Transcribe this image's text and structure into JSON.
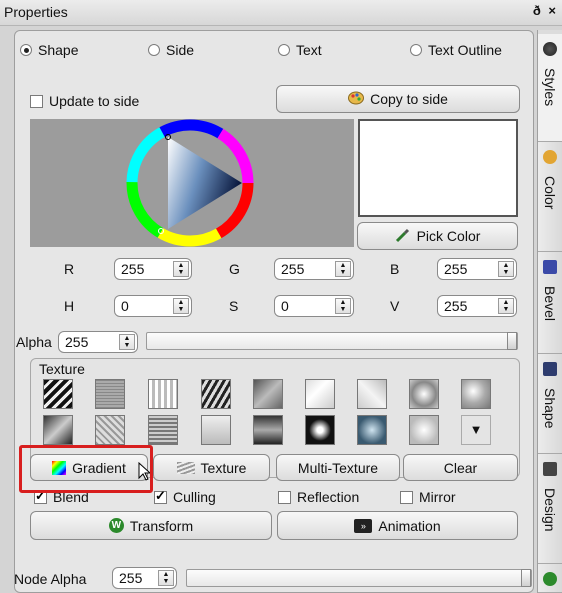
{
  "window": {
    "title": "Properties",
    "controls": "ð ×"
  },
  "mode_radios": [
    {
      "label": "Shape",
      "selected": true
    },
    {
      "label": "Side",
      "selected": false
    },
    {
      "label": "Text",
      "selected": false
    },
    {
      "label": "Text Outline",
      "selected": false
    }
  ],
  "update_to_side": {
    "label": "Update to side",
    "checked": false
  },
  "copy_to_side": {
    "label": "Copy to side",
    "icon": "palette-icon"
  },
  "color_picker": {
    "current_color": "#ffffff",
    "pick_color_label": "Pick Color",
    "pick_icon": "eyedropper-icon"
  },
  "rgb": {
    "r_label": "R",
    "r": "255",
    "g_label": "G",
    "g": "255",
    "b_label": "B",
    "b": "255"
  },
  "hsv": {
    "h_label": "H",
    "h": "0",
    "s_label": "S",
    "s": "0",
    "v_label": "V",
    "v": "255"
  },
  "alpha": {
    "label": "Alpha",
    "value": "255",
    "level": 1.0
  },
  "texture": {
    "title": "Texture"
  },
  "texture_buttons": [
    {
      "label": "Gradient",
      "icon": "gradient-icon"
    },
    {
      "label": "Texture",
      "icon": "texture-icon"
    },
    {
      "label": "Multi-Texture"
    },
    {
      "label": "Clear"
    }
  ],
  "options": [
    {
      "label": "Blend",
      "checked": true
    },
    {
      "label": "Culling",
      "checked": true
    },
    {
      "label": "Reflection",
      "checked": false
    },
    {
      "label": "Mirror",
      "checked": false
    }
  ],
  "transform_button": {
    "label": "Transform",
    "icon": "transform-icon"
  },
  "animation_button": {
    "label": "Animation",
    "icon": "animation-icon"
  },
  "node_alpha": {
    "label": "Node Alpha",
    "value": "255",
    "level": 1.0
  },
  "side_tabs": [
    {
      "label": "Styles",
      "icon": "styles-icon"
    },
    {
      "label": "Color",
      "icon": "color-icon"
    },
    {
      "label": "Bevel",
      "icon": "bevel-icon"
    },
    {
      "label": "Shape",
      "icon": "shape-icon"
    },
    {
      "label": "Design",
      "icon": "design-icon"
    }
  ]
}
